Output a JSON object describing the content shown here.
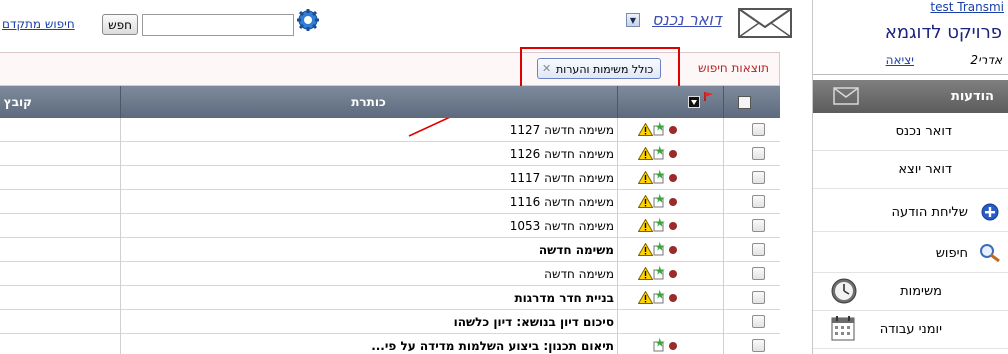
{
  "app": {
    "account_link": "test Transmi",
    "project_title": "פרויקט לדוגמא",
    "user_name": "אדרי2",
    "logout_label": "יציאה"
  },
  "sidebar": {
    "messages_header": "הודעות",
    "items": [
      {
        "label": "דואר נכנס",
        "icon": ""
      },
      {
        "label": "דואר יוצא",
        "icon": ""
      },
      {
        "label": "שליחת הודעה",
        "icon": "plus-circle-icon"
      },
      {
        "label": "חיפוש",
        "icon": "magnifier-icon"
      },
      {
        "label": "משימות",
        "icon": "clock-icon"
      },
      {
        "label": "יומני עבודה",
        "icon": "calendar-icon"
      }
    ]
  },
  "topbar": {
    "inbox_label": "דואר נכנס",
    "search_value": "",
    "search_button": "חפש",
    "advanced_search": "חיפוש מתקדם"
  },
  "results": {
    "title": "תוצאות חיפוש",
    "filter_chip": "כולל משימות והערות"
  },
  "table": {
    "columns": {
      "title": "כותרת",
      "file": "קובץ"
    },
    "rows": [
      {
        "subject": "משימה חדשה 1127",
        "bold": false,
        "warn": true,
        "task": true,
        "dot": true
      },
      {
        "subject": "משימה חדשה 1126",
        "bold": false,
        "warn": true,
        "task": true,
        "dot": true
      },
      {
        "subject": "משימה חדשה 1117",
        "bold": false,
        "warn": true,
        "task": true,
        "dot": true
      },
      {
        "subject": "משימה חדשה 1116",
        "bold": false,
        "warn": true,
        "task": true,
        "dot": true
      },
      {
        "subject": "משימה חדשה 1053",
        "bold": false,
        "warn": true,
        "task": true,
        "dot": true
      },
      {
        "subject": "משימה חדשה",
        "bold": true,
        "warn": true,
        "task": true,
        "dot": true
      },
      {
        "subject": "משימה חדשה",
        "bold": false,
        "warn": true,
        "task": true,
        "dot": true
      },
      {
        "subject": "בניית חדר מדרגות",
        "bold": true,
        "warn": true,
        "task": true,
        "dot": true
      },
      {
        "subject": "סיכום דיון בנושא: דיון כלשהו",
        "bold": true,
        "warn": false,
        "task": false,
        "dot": false
      },
      {
        "subject": "תיאום תכנון: ביצוע השלמות מדידה על פי...",
        "bold": true,
        "warn": false,
        "task": true,
        "dot": true
      }
    ]
  },
  "colors": {
    "header_bg": "#6d7a8d",
    "sidebar_header_bg": "#6e6e6e",
    "annotation_red": "#e00000",
    "priority_dot": "#9b2a2a"
  }
}
